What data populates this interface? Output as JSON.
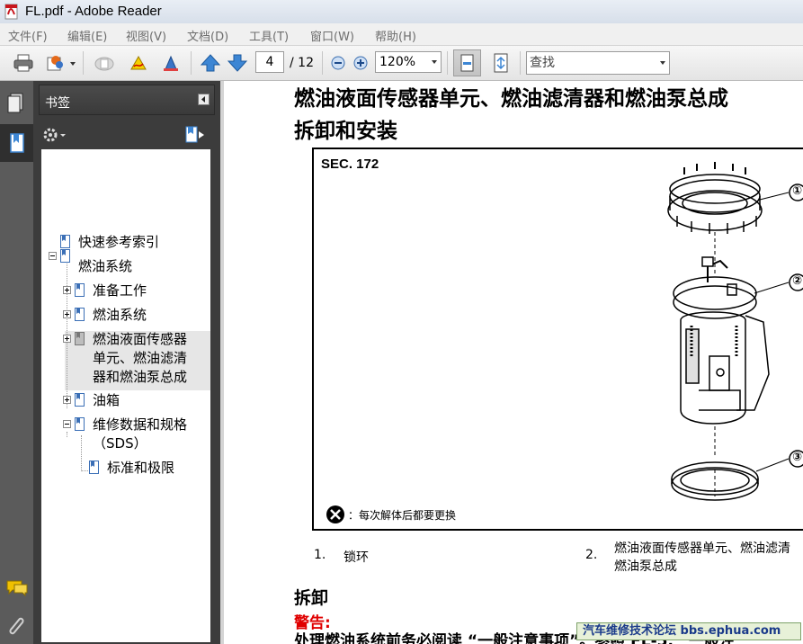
{
  "window": {
    "title": "FL.pdf - Adobe Reader"
  },
  "menu": [
    "文件(F)",
    "编辑(E)",
    "视图(V)",
    "文档(D)",
    "工具(T)",
    "窗口(W)",
    "帮助(H)"
  ],
  "toolbar": {
    "page_current": "4",
    "page_total": "/ 12",
    "zoom": "120%",
    "search_placeholder": "查找",
    "icons": [
      "print-icon",
      "collaborate-icon",
      "cloud-icon",
      "sign-icon",
      "highlight-icon",
      "page-up-icon",
      "page-down-icon",
      "zoom-out-icon",
      "zoom-in-icon",
      "fit-width-icon",
      "fit-page-icon"
    ]
  },
  "bookmarks": {
    "title": "书签",
    "items": [
      {
        "label": "快速参考索引",
        "level": 0
      },
      {
        "label": "燃油系统",
        "level": 0
      },
      {
        "label": "准备工作",
        "level": 1
      },
      {
        "label": "燃油系统",
        "level": 1
      },
      {
        "label": "燃油液面传感器单元、燃油滤清器和燃油泵总成",
        "lines": [
          "燃油液面传感器",
          "单元、燃油滤清",
          "器和燃油泵总成"
        ],
        "level": 1,
        "selected": true
      },
      {
        "label": "油箱",
        "level": 1
      },
      {
        "label": "维修数据和规格（SDS）",
        "lines": [
          "维修数据和规格",
          "（SDS）"
        ],
        "level": 1
      },
      {
        "label": "标准和极限",
        "level": 2
      }
    ]
  },
  "document": {
    "heading_line1": "燃油液面传感器单元、燃油滤清器和燃油泵总成",
    "heading_line2": "拆卸和安装",
    "figure": {
      "section": "SEC. 172",
      "callouts": [
        "①",
        "②",
        "③"
      ],
      "note": "：每次解体后都要更换"
    },
    "captions": [
      {
        "num": "1.",
        "text": "锁环"
      },
      {
        "num": "2.",
        "text_line1": "燃油液面传感器单元、燃油滤清",
        "text_line2": "燃油泵总成"
      }
    ],
    "section_title": "拆卸",
    "warning": "警告:",
    "body_line": "处理燃油系统前务必阅读 “一般注意事项”。参照 FL-5, “一般注"
  },
  "watermark": "汽车维修技术论坛 bbs.ephua.com"
}
